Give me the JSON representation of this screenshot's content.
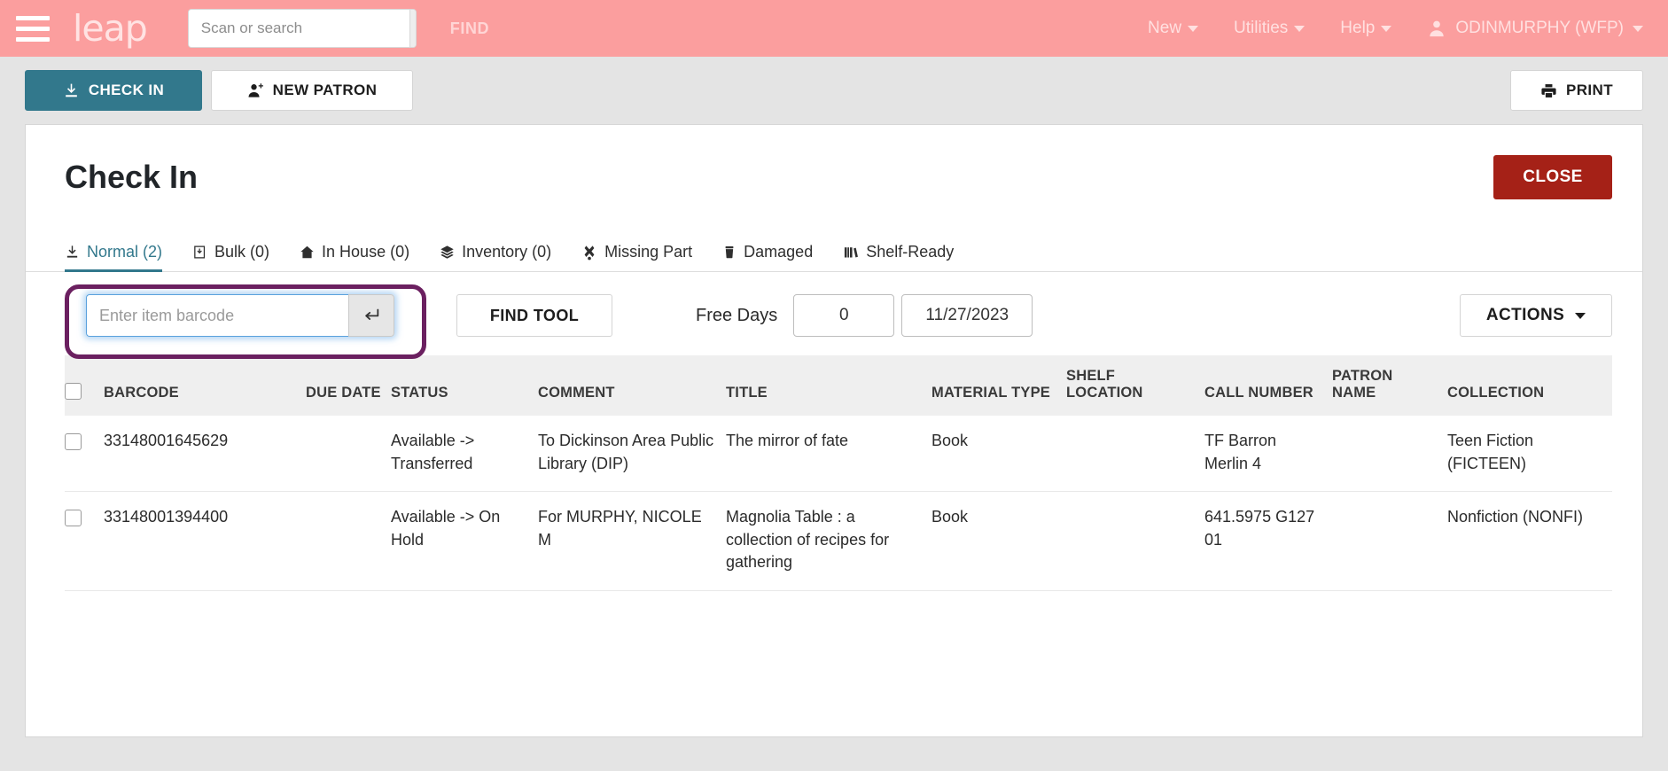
{
  "header": {
    "brand": "leap",
    "menu_icon": "hamburger-icon",
    "search": {
      "placeholder": "Scan or search",
      "value": "",
      "button_icon": "search-icon"
    },
    "find_label": "FIND",
    "menus": [
      {
        "label": "New"
      },
      {
        "label": "Utilities"
      },
      {
        "label": "Help"
      }
    ],
    "user": "ODINMURPHY (WFP)"
  },
  "toolbar": {
    "check_in_label": "CHECK IN",
    "new_patron_label": "NEW PATRON",
    "print_label": "PRINT"
  },
  "workform": {
    "title": "Check In",
    "close_label": "CLOSE",
    "tabs": [
      {
        "label": "Normal (2)",
        "icon": "check-in-icon",
        "active": true
      },
      {
        "label": "Bulk (0)",
        "icon": "bulk-icon",
        "active": false
      },
      {
        "label": "In House (0)",
        "icon": "house-icon",
        "active": false
      },
      {
        "label": "Inventory (0)",
        "icon": "layers-icon",
        "active": false
      },
      {
        "label": "Missing Part",
        "icon": "missing-part-icon",
        "active": false
      },
      {
        "label": "Damaged",
        "icon": "trash-icon",
        "active": false
      },
      {
        "label": "Shelf-Ready",
        "icon": "books-icon",
        "active": false
      }
    ],
    "controls": {
      "barcode_placeholder": "Enter item barcode",
      "barcode_value": "",
      "enter_icon": "enter-key-icon",
      "find_tool_label": "FIND TOOL",
      "free_days_label": "Free Days",
      "free_days_value": "0",
      "date_value": "11/27/2023",
      "actions_label": "ACTIONS"
    },
    "table": {
      "columns": [
        "BARCODE",
        "DUE DATE",
        "STATUS",
        "COMMENT",
        "TITLE",
        "MATERIAL TYPE",
        "SHELF LOCATION",
        "CALL NUMBER",
        "PATRON NAME",
        "COLLECTION"
      ],
      "rows": [
        {
          "barcode": "33148001645629",
          "due_date": "",
          "status": "Available -> Transferred",
          "comment": "To Dickinson Area Public Library (DIP)",
          "title": "The mirror of fate",
          "material_type": "Book",
          "shelf_location": "",
          "call_number": "TF Barron Merlin 4",
          "patron_name": "",
          "collection": "Teen Fiction (FICTEEN)"
        },
        {
          "barcode": "33148001394400",
          "due_date": "",
          "status": "Available -> On Hold",
          "comment": "For MURPHY, NICOLE M",
          "title": "Magnolia Table : a collection of recipes for gathering",
          "material_type": "Book",
          "shelf_location": "",
          "call_number": "641.5975 G127 01",
          "patron_name": "",
          "collection": "Nonfiction (NONFI)"
        }
      ]
    }
  },
  "colors": {
    "header_bg": "#fb9e9e",
    "accent_teal": "#32788c",
    "close_red": "#a52117",
    "highlight_purple": "#6b2060",
    "focus_blue": "#5aa1dd"
  }
}
